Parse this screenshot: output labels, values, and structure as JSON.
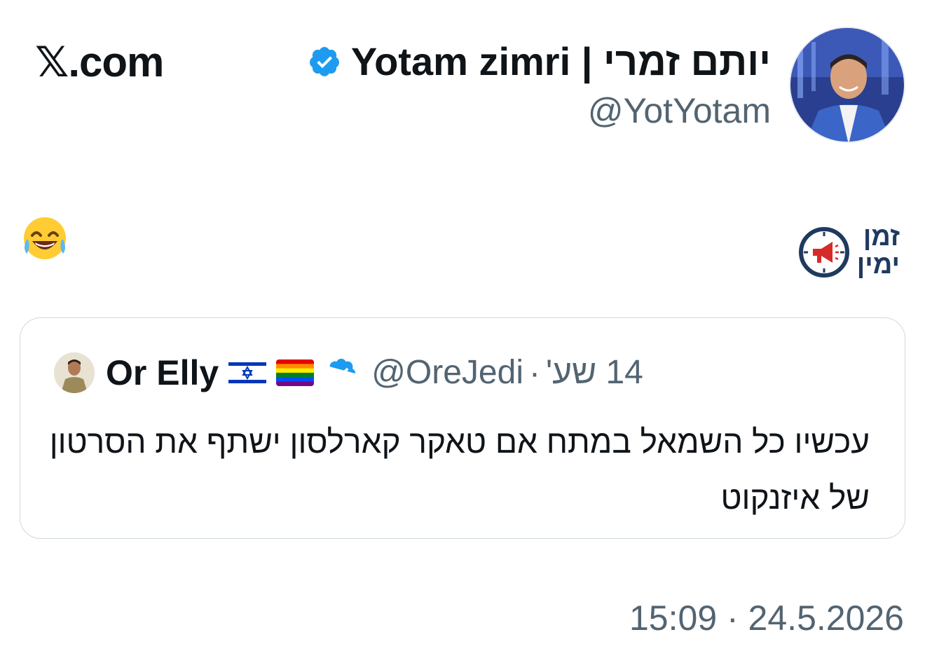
{
  "site": {
    "label": "X.com",
    "x_glyph": "𝕏",
    "suffix": ".com"
  },
  "author": {
    "display_name": "Yotam zimri | יותם זמרי",
    "handle": "@YotYotam",
    "verified": true,
    "avatar_icon": "user-avatar-photo"
  },
  "post": {
    "emoji": "😂",
    "emoji_name": "face-with-tears-of-joy",
    "brand_logo": {
      "line1": "זמן",
      "line2": "ימין",
      "icon": "clock-megaphone-icon",
      "color": "#1f3a5f",
      "accent": "#d62b2b"
    }
  },
  "quoted": {
    "name": "Or Elly",
    "flags": [
      "israel-flag-icon",
      "rainbow-flag-icon"
    ],
    "verified": true,
    "handle": "@OreJedi",
    "separator": "·",
    "time": "14 שע'",
    "text": "עכשיו כל השמאל במתח אם טאקר קארלסון ישתף את הסרטון של איזנקוט"
  },
  "footer": {
    "timestamp": "15:09 · 24.5.2026"
  },
  "colors": {
    "text": "#0f1419",
    "muted": "#536471",
    "verified": "#1d9bf0",
    "border": "#cfd9de"
  }
}
